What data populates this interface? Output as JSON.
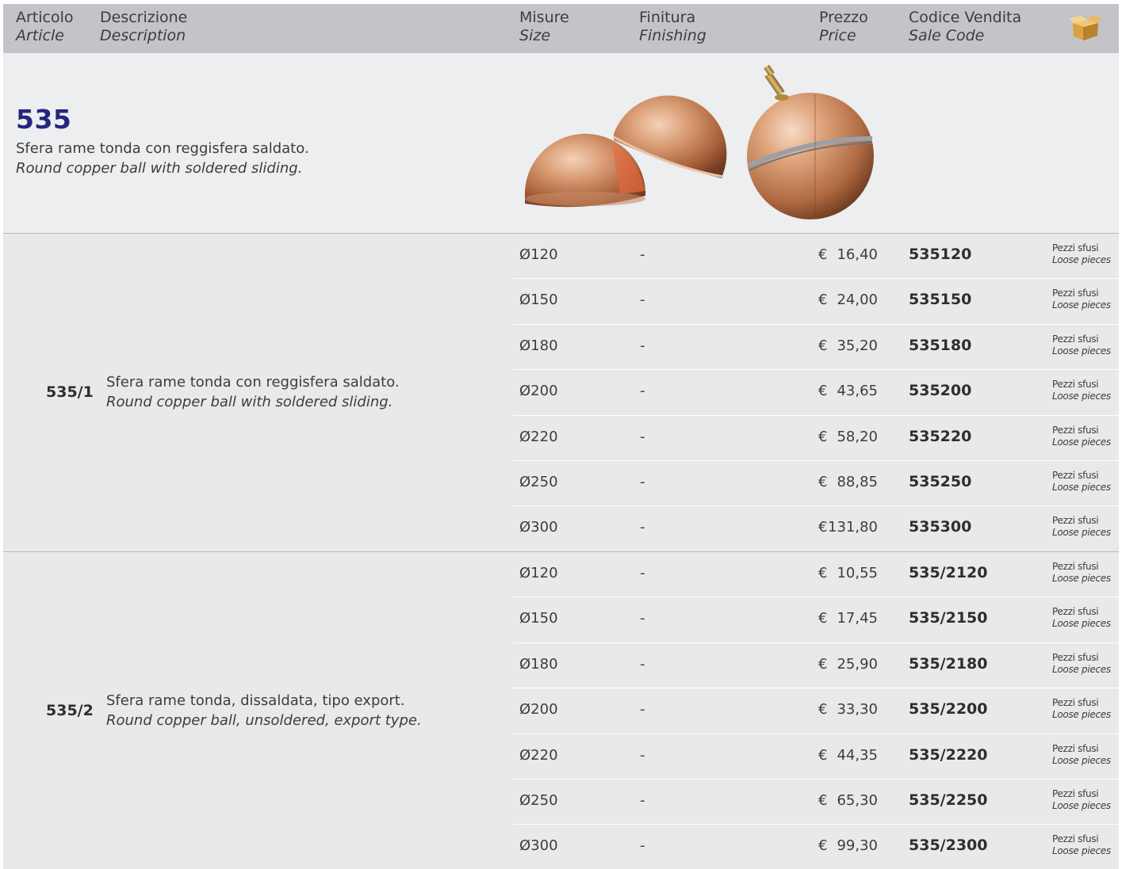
{
  "header": {
    "article_it": "Articolo",
    "article_en": "Article",
    "description_it": "Descrizione",
    "description_en": "Description",
    "size_it": "Misure",
    "size_en": "Size",
    "finishing_it": "Finitura",
    "finishing_en": "Finishing",
    "price_it": "Prezzo",
    "price_en": "Price",
    "code_it": "Codice Vendita",
    "code_en": "Sale Code",
    "box_icon": "cardboard-box-icon"
  },
  "hero": {
    "code": "535",
    "desc_it": "Sfera rame tonda con reggisfera saldato.",
    "desc_en": "Round copper ball with soldered sliding.",
    "image": "copper-ball-photo"
  },
  "groups": [
    {
      "code": "535/1",
      "desc_it": "Sfera rame tonda con reggisfera saldato.",
      "desc_en": "Round copper ball with soldered sliding.",
      "rows": [
        {
          "size": "Ø120",
          "finishing": "-",
          "currency": "€",
          "price": "16,40",
          "code": "535120",
          "pack_it": "Pezzi sfusi",
          "pack_en": "Loose pieces"
        },
        {
          "size": "Ø150",
          "finishing": "-",
          "currency": "€",
          "price": "24,00",
          "code": "535150",
          "pack_it": "Pezzi sfusi",
          "pack_en": "Loose pieces"
        },
        {
          "size": "Ø180",
          "finishing": "-",
          "currency": "€",
          "price": "35,20",
          "code": "535180",
          "pack_it": "Pezzi sfusi",
          "pack_en": "Loose pieces"
        },
        {
          "size": "Ø200",
          "finishing": "-",
          "currency": "€",
          "price": "43,65",
          "code": "535200",
          "pack_it": "Pezzi sfusi",
          "pack_en": "Loose pieces"
        },
        {
          "size": "Ø220",
          "finishing": "-",
          "currency": "€",
          "price": "58,20",
          "code": "535220",
          "pack_it": "Pezzi sfusi",
          "pack_en": "Loose pieces"
        },
        {
          "size": "Ø250",
          "finishing": "-",
          "currency": "€",
          "price": "88,85",
          "code": "535250",
          "pack_it": "Pezzi sfusi",
          "pack_en": "Loose pieces"
        },
        {
          "size": "Ø300",
          "finishing": "-",
          "currency": "€",
          "price": "131,80",
          "code": "535300",
          "pack_it": "Pezzi sfusi",
          "pack_en": "Loose pieces"
        }
      ]
    },
    {
      "code": "535/2",
      "desc_it": "Sfera rame tonda, dissaldata, tipo export.",
      "desc_en": "Round copper ball, unsoldered, export type.",
      "rows": [
        {
          "size": "Ø120",
          "finishing": "-",
          "currency": "€",
          "price": "10,55",
          "code": "535/2120",
          "pack_it": "Pezzi sfusi",
          "pack_en": "Loose pieces"
        },
        {
          "size": "Ø150",
          "finishing": "-",
          "currency": "€",
          "price": "17,45",
          "code": "535/2150",
          "pack_it": "Pezzi sfusi",
          "pack_en": "Loose pieces"
        },
        {
          "size": "Ø180",
          "finishing": "-",
          "currency": "€",
          "price": "25,90",
          "code": "535/2180",
          "pack_it": "Pezzi sfusi",
          "pack_en": "Loose pieces"
        },
        {
          "size": "Ø200",
          "finishing": "-",
          "currency": "€",
          "price": "33,30",
          "code": "535/2200",
          "pack_it": "Pezzi sfusi",
          "pack_en": "Loose pieces"
        },
        {
          "size": "Ø220",
          "finishing": "-",
          "currency": "€",
          "price": "44,35",
          "code": "535/2220",
          "pack_it": "Pezzi sfusi",
          "pack_en": "Loose pieces"
        },
        {
          "size": "Ø250",
          "finishing": "-",
          "currency": "€",
          "price": "65,30",
          "code": "535/2250",
          "pack_it": "Pezzi sfusi",
          "pack_en": "Loose pieces"
        },
        {
          "size": "Ø300",
          "finishing": "-",
          "currency": "€",
          "price": "99,30",
          "code": "535/2300",
          "pack_it": "Pezzi sfusi",
          "pack_en": "Loose pieces"
        }
      ]
    }
  ],
  "colors": {
    "header_bg": "#c2c4c8",
    "sheet_bg": "#e8e9eb",
    "hero_code": "#262680",
    "copper": "#c98a62"
  }
}
